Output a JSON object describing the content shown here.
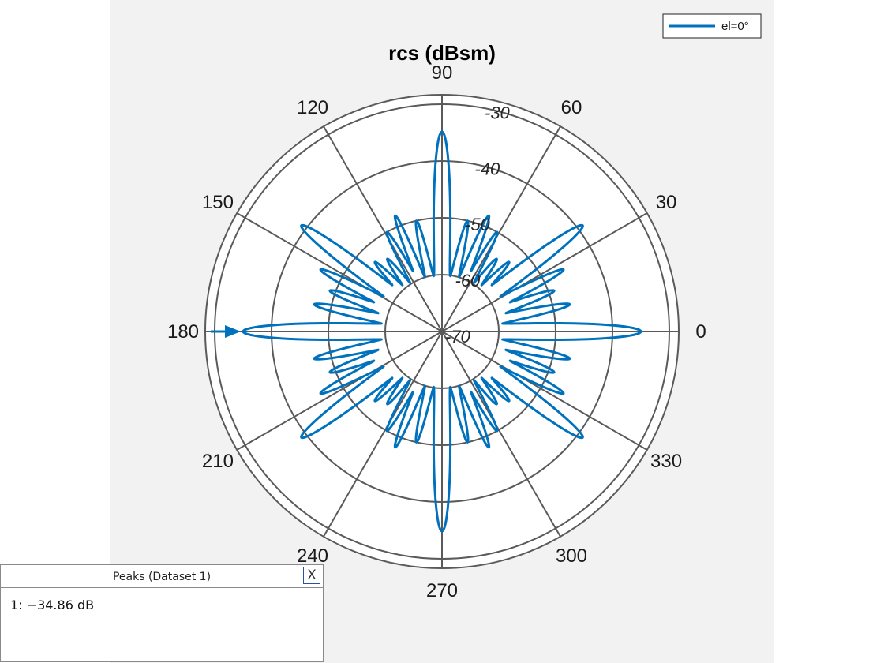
{
  "chart_data": {
    "type": "polar-line",
    "title": "rcs (dBsm)",
    "legend": {
      "entries": [
        "el=0°"
      ],
      "placement": "top-right"
    },
    "angle_ticks": [
      "0",
      "30",
      "60",
      "90",
      "120",
      "150",
      "180",
      "210",
      "240",
      "270",
      "300",
      "330"
    ],
    "magnitude_ticks": [
      "-70",
      "-60",
      "-50",
      "-40",
      "-30"
    ],
    "rlim": [
      -70,
      -30
    ],
    "series": [
      {
        "name": "el=0°",
        "color": "#0072bd",
        "lobes": [
          {
            "angle": 0,
            "value": -35,
            "width": 3.2
          },
          {
            "angle": 12,
            "value": -47,
            "width": 2.2
          },
          {
            "angle": 20,
            "value": -49,
            "width": 2.2
          },
          {
            "angle": 27,
            "value": -46,
            "width": 2.2
          },
          {
            "angle": 37,
            "value": -39,
            "width": 3.0
          },
          {
            "angle": 46,
            "value": -53,
            "width": 2.0
          },
          {
            "angle": 53,
            "value": -54,
            "width": 2.0
          },
          {
            "angle": 61,
            "value": -50,
            "width": 2.0
          },
          {
            "angle": 68,
            "value": -48,
            "width": 2.0
          },
          {
            "angle": 77,
            "value": -50,
            "width": 2.0
          },
          {
            "angle": 90,
            "value": -34.86,
            "width": 3.2
          },
          {
            "angle": 103,
            "value": -50,
            "width": 2.0
          },
          {
            "angle": 112,
            "value": -48,
            "width": 2.0
          },
          {
            "angle": 119,
            "value": -50,
            "width": 2.0
          },
          {
            "angle": 127,
            "value": -54,
            "width": 2.0
          },
          {
            "angle": 134,
            "value": -53,
            "width": 2.0
          },
          {
            "angle": 143,
            "value": -39,
            "width": 3.0
          },
          {
            "angle": 153,
            "value": -46,
            "width": 2.2
          },
          {
            "angle": 160,
            "value": -49,
            "width": 2.2
          },
          {
            "angle": 168,
            "value": -47,
            "width": 2.2
          },
          {
            "angle": 180,
            "value": -35,
            "width": 3.2
          },
          {
            "angle": 192,
            "value": -47,
            "width": 2.2
          },
          {
            "angle": 200,
            "value": -49,
            "width": 2.2
          },
          {
            "angle": 207,
            "value": -46,
            "width": 2.2
          },
          {
            "angle": 217,
            "value": -39,
            "width": 3.0
          },
          {
            "angle": 226,
            "value": -53,
            "width": 2.0
          },
          {
            "angle": 233,
            "value": -54,
            "width": 2.0
          },
          {
            "angle": 241,
            "value": -50,
            "width": 2.0
          },
          {
            "angle": 248,
            "value": -48,
            "width": 2.0
          },
          {
            "angle": 257,
            "value": -50,
            "width": 2.0
          },
          {
            "angle": 270,
            "value": -34.86,
            "width": 3.2
          },
          {
            "angle": 283,
            "value": -50,
            "width": 2.0
          },
          {
            "angle": 292,
            "value": -48,
            "width": 2.0
          },
          {
            "angle": 299,
            "value": -50,
            "width": 2.0
          },
          {
            "angle": 307,
            "value": -54,
            "width": 2.0
          },
          {
            "angle": 314,
            "value": -53,
            "width": 2.0
          },
          {
            "angle": 323,
            "value": -39,
            "width": 3.0
          },
          {
            "angle": 333,
            "value": -46,
            "width": 2.2
          },
          {
            "angle": 340,
            "value": -49,
            "width": 2.2
          },
          {
            "angle": 348,
            "value": -47,
            "width": 2.2
          }
        ],
        "null_level": -61
      }
    ],
    "peak_marker": {
      "angle": 180,
      "value": -34.86,
      "label": "1"
    },
    "grid": true
  },
  "peaks_panel": {
    "title": "Peaks (Dataset 1)",
    "close_label": "X",
    "entries": [
      "1: −34.86 dB"
    ]
  }
}
